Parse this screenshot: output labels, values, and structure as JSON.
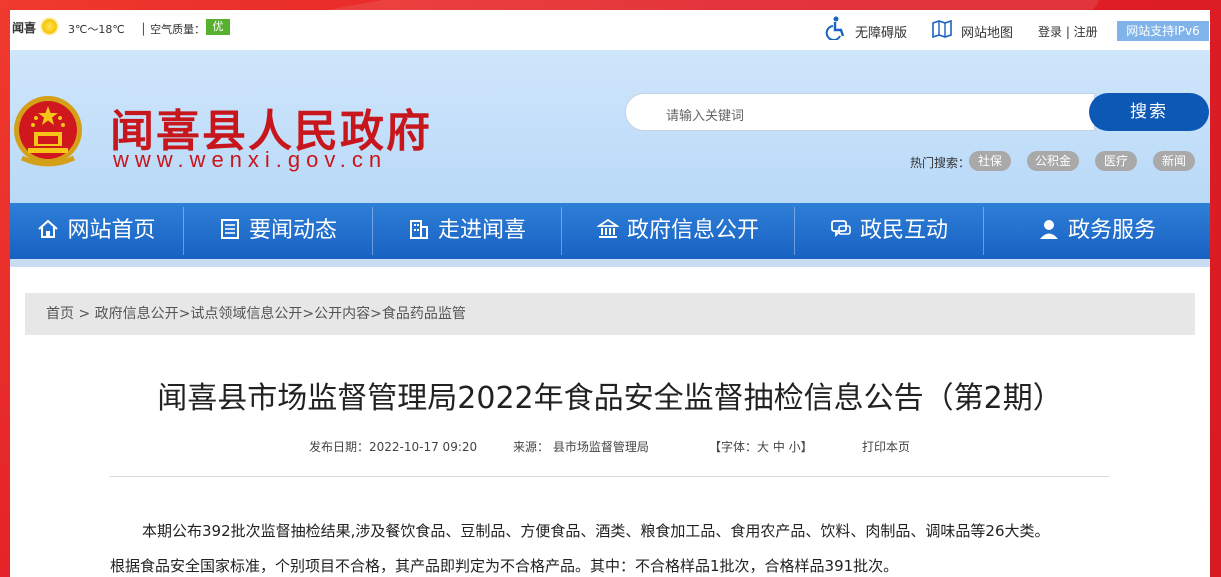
{
  "topbar": {
    "location": "闻喜",
    "temperature": "3℃～18℃",
    "air_quality_label": "空气质量：",
    "air_quality_value": "优",
    "accessibility": "无障碍版",
    "sitemap": "网站地图",
    "login_register": "登录 | 注册",
    "ipv6": "网站支持IPv6"
  },
  "header": {
    "title": "闻喜县人民政府",
    "url": "www.wenxi.gov.cn",
    "search_placeholder": "请输入关键词",
    "search_button": "搜索",
    "hot_label": "热门搜索：",
    "hot_tags": [
      "社保",
      "公积金",
      "医疗",
      "新闻"
    ]
  },
  "nav": {
    "items": [
      {
        "label": "网站首页",
        "icon": "home-icon"
      },
      {
        "label": "要闻动态",
        "icon": "news-icon"
      },
      {
        "label": "走进闻喜",
        "icon": "building-icon"
      },
      {
        "label": "政府信息公开",
        "icon": "government-icon"
      },
      {
        "label": "政民互动",
        "icon": "chat-icon"
      },
      {
        "label": "政务服务",
        "icon": "user-icon"
      }
    ]
  },
  "breadcrumb": "首页 > 政府信息公开>试点领域信息公开>公开内容>食品药品监管",
  "article": {
    "title": "闻喜县市场监督管理局2022年食品安全监督抽检信息公告（第2期）",
    "publish_date": "发布日期：2022-10-17 09:20",
    "source": "来源： 县市场监督管理局",
    "font_size": "【字体：大 中 小】",
    "print": "打印本页",
    "paragraph1": "本期公布392批次监督抽检结果,涉及餐饮食品、豆制品、方便食品、酒类、粮食加工品、食用农产品、饮料、肉制品、调味品等26大类。",
    "paragraph2": "根据食品安全国家标准，个别项目不合格，其产品即判定为不合格产品。其中：不合格样品1批次，合格样品391批次。"
  },
  "colors": {
    "brand_red": "#c8161d",
    "nav_blue": "#1861c2",
    "header_blue": "#cfe6fb",
    "aq_green": "#58b030"
  }
}
